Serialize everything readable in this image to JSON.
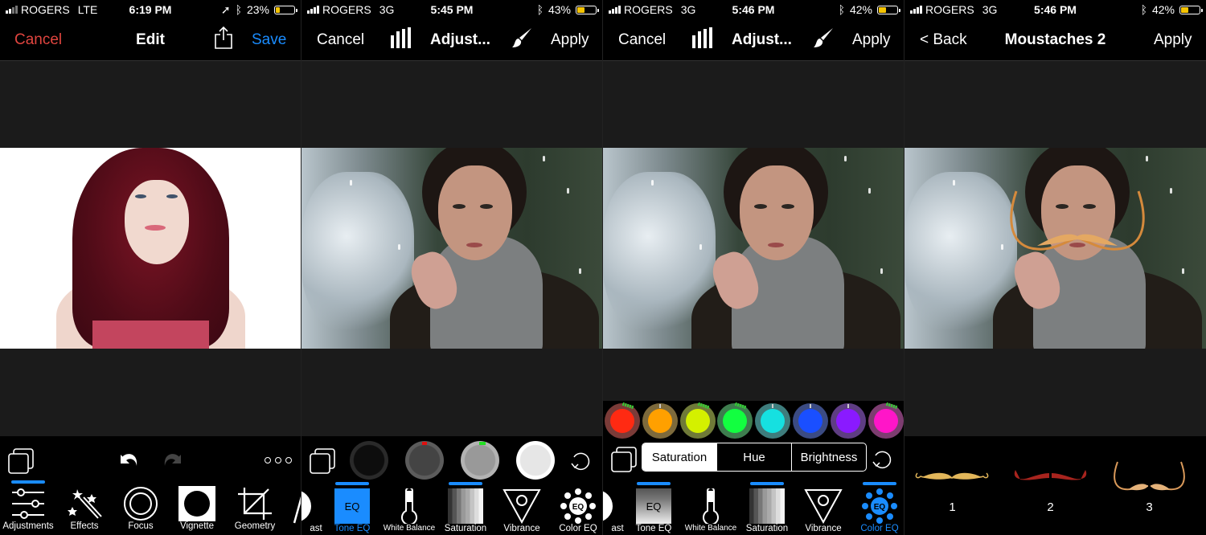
{
  "colors": {
    "accent_blue": "#1a8cff",
    "cancel_red": "#e0453f",
    "canvas_bg": "#1b1b1b",
    "toolbar_bg": "#000000",
    "battery_fill": "#f5c400"
  },
  "panels": [
    {
      "status": {
        "carrier": "ROGERS",
        "network": "LTE",
        "time": "6:19 PM",
        "battery": "23%",
        "battery_level": 0.23,
        "location_icon": "location-arrow-icon",
        "bluetooth_icon": "bluetooth-icon"
      },
      "nav": {
        "cancel": "Cancel",
        "title": "Edit",
        "share_icon": "share-icon",
        "save": "Save"
      },
      "toolbar": {
        "layers_icon": "layers-icon",
        "undo_icon": "undo-icon",
        "redo_icon": "redo-icon",
        "more_icon": "more-icon",
        "tools": [
          {
            "label": "Adjustments",
            "icon": "sliders-icon",
            "active": true
          },
          {
            "label": "Effects",
            "icon": "magic-wand-icon",
            "active": false
          },
          {
            "label": "Focus",
            "icon": "focus-rings-icon",
            "active": false
          },
          {
            "label": "Vignette",
            "icon": "vignette-icon",
            "active": false
          },
          {
            "label": "Geometry",
            "icon": "crop-icon",
            "active": false
          }
        ]
      }
    },
    {
      "status": {
        "carrier": "ROGERS",
        "network": "3G",
        "time": "5:45 PM",
        "battery": "43%",
        "battery_level": 0.43,
        "bluetooth_icon": "bluetooth-icon"
      },
      "nav": {
        "cancel": "Cancel",
        "histogram_icon": "histogram-icon",
        "title": "Adjust...",
        "brush_icon": "brush-icon",
        "apply": "Apply"
      },
      "toolbar": {
        "dials": [
          {
            "name": "shadows-dial",
            "tone": "#1c1c1c"
          },
          {
            "name": "darks-dial",
            "tone": "#4a4a4a"
          },
          {
            "name": "lights-dial",
            "tone": "#9a9a9a"
          },
          {
            "name": "highlights-dial",
            "tone": "#eeeeee"
          }
        ],
        "reset_icon": "reset-icon",
        "tools": [
          {
            "label": "ast",
            "icon": "contrast-icon",
            "active": false
          },
          {
            "label": "Tone EQ",
            "icon": "tone-eq-icon",
            "active": true,
            "icon_text": "EQ"
          },
          {
            "label": "White Balance",
            "icon": "thermometer-icon",
            "active": false
          },
          {
            "label": "Saturation",
            "icon": "saturation-icon",
            "active": false,
            "indicator": true
          },
          {
            "label": "Vibrance",
            "icon": "vibrance-icon",
            "active": false
          },
          {
            "label": "Color EQ",
            "icon": "color-eq-icon",
            "active": false,
            "icon_text": "EQ"
          }
        ]
      }
    },
    {
      "status": {
        "carrier": "ROGERS",
        "network": "3G",
        "time": "5:46 PM",
        "battery": "42%",
        "battery_level": 0.42,
        "bluetooth_icon": "bluetooth-icon"
      },
      "nav": {
        "cancel": "Cancel",
        "histogram_icon": "histogram-icon",
        "title": "Adjust...",
        "brush_icon": "brush-icon",
        "apply": "Apply"
      },
      "toolbar": {
        "color_dials": [
          {
            "name": "red",
            "color": "#ff2a12",
            "ring": "#7b3b38",
            "adjusted": true
          },
          {
            "name": "orange",
            "color": "#ffa000",
            "ring": "#7d6a3c",
            "adjusted": false
          },
          {
            "name": "yellow",
            "color": "#d4f000",
            "ring": "#6f7a38",
            "adjusted": true
          },
          {
            "name": "green",
            "color": "#12ff40",
            "ring": "#3d7d4e",
            "adjusted": true
          },
          {
            "name": "aqua",
            "color": "#16e0e0",
            "ring": "#3e7d7d",
            "adjusted": false
          },
          {
            "name": "blue",
            "color": "#1a4fff",
            "ring": "#3b4b83",
            "adjusted": false
          },
          {
            "name": "purple",
            "color": "#8a1aff",
            "ring": "#5e3d83",
            "adjusted": false
          },
          {
            "name": "magenta",
            "color": "#ff16c8",
            "ring": "#7d3d70",
            "adjusted": true
          }
        ],
        "segments": [
          {
            "label": "Saturation",
            "selected": true
          },
          {
            "label": "Hue",
            "selected": false
          },
          {
            "label": "Brightness",
            "selected": false
          }
        ],
        "reset_icon": "reset-icon",
        "tools": [
          {
            "label": "ast",
            "icon": "contrast-icon",
            "active": false
          },
          {
            "label": "Tone EQ",
            "icon": "tone-eq-icon",
            "active": false,
            "icon_text": "EQ",
            "indicator": true
          },
          {
            "label": "White Balance",
            "icon": "thermometer-icon",
            "active": false
          },
          {
            "label": "Saturation",
            "icon": "saturation-icon",
            "active": false,
            "indicator": true
          },
          {
            "label": "Vibrance",
            "icon": "vibrance-icon",
            "active": false
          },
          {
            "label": "Color EQ",
            "icon": "color-eq-icon",
            "active": true,
            "icon_text": "EQ"
          }
        ]
      }
    },
    {
      "status": {
        "carrier": "ROGERS",
        "network": "3G",
        "time": "5:46 PM",
        "battery": "42%",
        "battery_level": 0.42,
        "bluetooth_icon": "bluetooth-icon"
      },
      "nav": {
        "back": "< Back",
        "title": "Moustaches 2",
        "apply": "Apply"
      },
      "toolbar": {
        "moustaches": [
          {
            "label": "1",
            "color": "#e2b65a"
          },
          {
            "label": "2",
            "color": "#a8241e"
          },
          {
            "label": "3",
            "color": "#d9995a"
          }
        ]
      }
    }
  ]
}
